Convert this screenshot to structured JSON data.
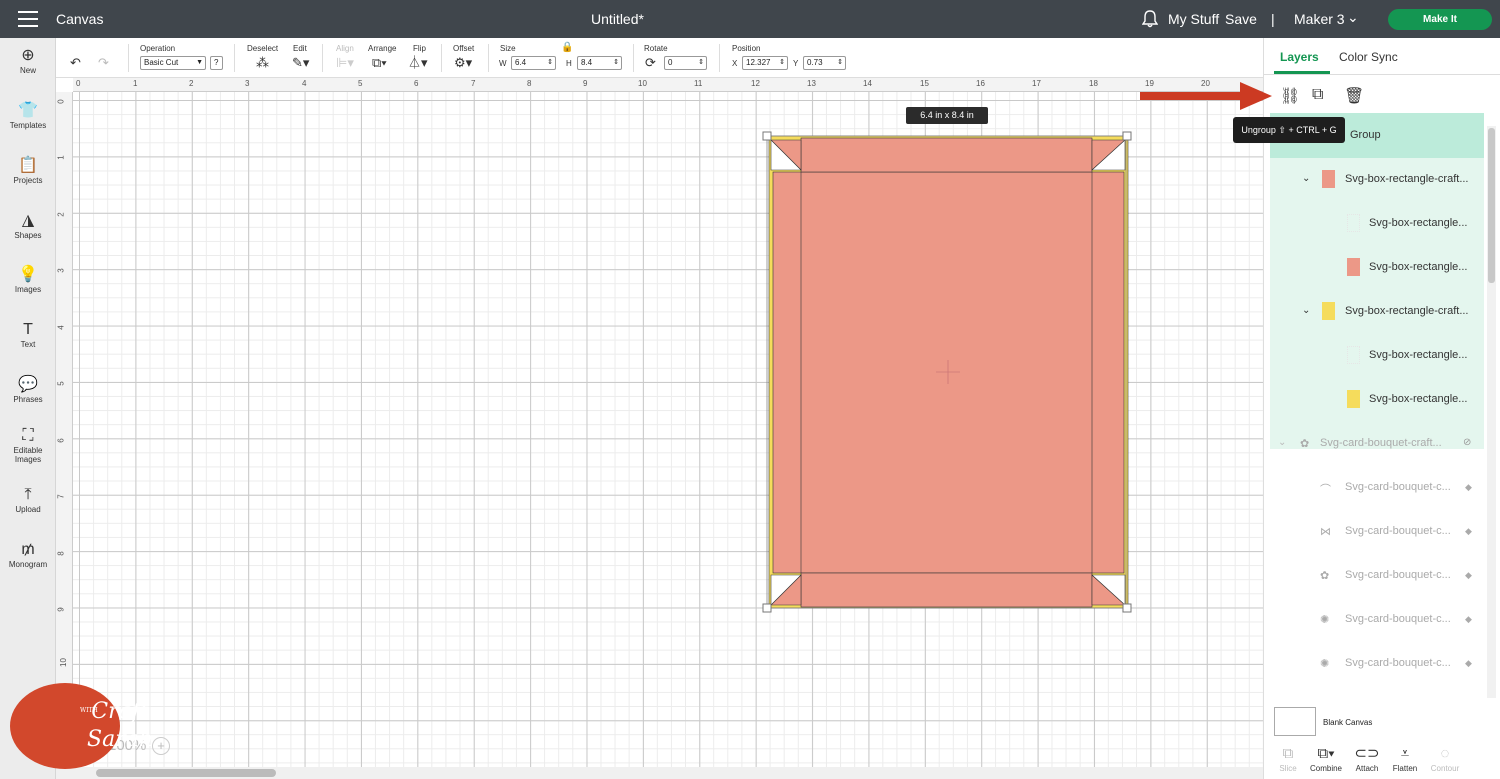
{
  "header": {
    "title": "Canvas",
    "document": "Untitled*",
    "my_stuff": "My Stuff",
    "save": "Save",
    "divider": "|",
    "machine": "Maker 3",
    "make_it": "Make It"
  },
  "sidebar": {
    "items": [
      {
        "label": "New",
        "icon": "plus-circle-icon"
      },
      {
        "label": "Templates",
        "icon": "shirt-icon"
      },
      {
        "label": "Projects",
        "icon": "clipboard-icon"
      },
      {
        "label": "Shapes",
        "icon": "shapes-icon"
      },
      {
        "label": "Images",
        "icon": "lightbulb-icon"
      },
      {
        "label": "Text",
        "icon": "text-icon"
      },
      {
        "label": "Phrases",
        "icon": "speech-bubble-icon"
      },
      {
        "label": "Editable",
        "label2": "Images",
        "icon": "editable-image-icon"
      },
      {
        "label": "Upload",
        "icon": "upload-icon"
      },
      {
        "label": "Monogram",
        "icon": "monogram-icon"
      }
    ]
  },
  "toolbar": {
    "operation_label": "Operation",
    "operation_value": "Basic Cut",
    "help": "?",
    "deselect": "Deselect",
    "edit": "Edit",
    "align": "Align",
    "arrange": "Arrange",
    "flip": "Flip",
    "offset": "Offset",
    "size": "Size",
    "w_label": "W",
    "w_value": "6.4",
    "h_label": "H",
    "h_value": "8.4",
    "rotate": "Rotate",
    "rotate_value": "0",
    "position": "Position",
    "x_label": "X",
    "x_value": "12.327",
    "y_label": "Y",
    "y_value": "0.73"
  },
  "ruler": {
    "top": [
      "0",
      "1",
      "2",
      "3",
      "4",
      "5",
      "6",
      "7",
      "8",
      "9",
      "10",
      "11",
      "12",
      "13",
      "14",
      "15",
      "16",
      "17",
      "18",
      "19",
      "20"
    ],
    "left": [
      "0",
      "1",
      "2",
      "3",
      "4",
      "5",
      "6",
      "7",
      "8",
      "9",
      "10"
    ]
  },
  "canvas": {
    "dimension_tip": "6.4  in x 8.4  in",
    "zoom": "100%",
    "zoom_plus": "+"
  },
  "logo": {
    "line1": "Craft",
    "with": "WITH",
    "line2": "Sarah"
  },
  "colors": {
    "accent": "#149652",
    "salmon": "#ec9887",
    "yellow": "#f5dc5c",
    "header": "#40464c",
    "arrow": "#cc3a22"
  },
  "panel": {
    "tabs": [
      "Layers",
      "Color Sync"
    ],
    "tooltip": "Ungroup ⇧ + CTRL + G",
    "group_label": "Group",
    "layers": [
      {
        "name": "Svg-box-rectangle-craft...",
        "swatch": "#ec9887",
        "sub": [
          {
            "name": "Svg-box-rectangle...",
            "swatch": "blank"
          },
          {
            "name": "Svg-box-rectangle...",
            "swatch": "#ec9887"
          }
        ]
      },
      {
        "name": "Svg-box-rectangle-craft...",
        "swatch": "#f5dc5c",
        "sub": [
          {
            "name": "Svg-box-rectangle...",
            "swatch": "blank"
          },
          {
            "name": "Svg-box-rectangle...",
            "swatch": "#f5dc5c"
          }
        ]
      }
    ],
    "hidden_group": "Svg-card-bouquet-craft...",
    "hidden_items": [
      "Svg-card-bouquet-c...",
      "Svg-card-bouquet-c...",
      "Svg-card-bouquet-c...",
      "Svg-card-bouquet-c...",
      "Svg-card-bouquet-c..."
    ],
    "blank_canvas": "Blank Canvas",
    "bottom_tools": [
      "Slice",
      "Combine",
      "Attach",
      "Flatten",
      "Contour"
    ]
  }
}
